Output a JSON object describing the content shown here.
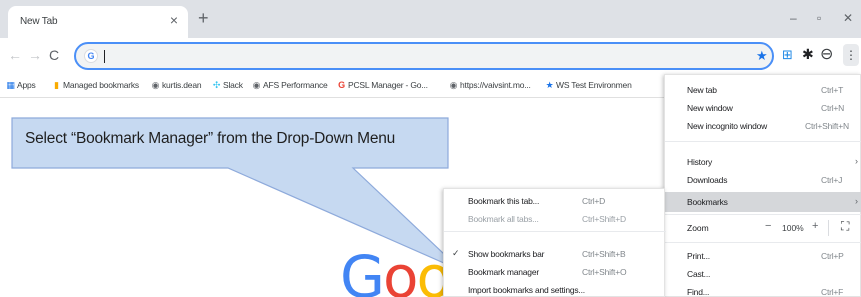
{
  "browser": {
    "tab_title": "New Tab",
    "tab_close": "×",
    "new_tab": "+",
    "window_controls": {
      "minimize": "–",
      "maximize": "▫",
      "close": "✕"
    }
  },
  "toolbar": {
    "back": "←",
    "forward": "→",
    "reload": "C",
    "omnibox_favicon": "G",
    "omnibox_value": "",
    "menu_glyph": "⋮"
  },
  "bookmarks_bar": [
    {
      "label": "Apps",
      "icon": "apps-grid-icon",
      "glyph": "▦",
      "color": "#1a73e8"
    },
    {
      "label": "Managed bookmarks",
      "icon": "folder-icon",
      "glyph": "▮",
      "color": "#f9ab00"
    },
    {
      "label": "kurtis.dean",
      "icon": "globe-icon",
      "glyph": "◉",
      "color": "#5f6368"
    },
    {
      "label": "Slack",
      "icon": "slack-icon",
      "glyph": "✣",
      "color": "#36c5f0"
    },
    {
      "label": "AFS Performance",
      "icon": "globe-icon",
      "glyph": "◉",
      "color": "#5f6368"
    },
    {
      "label": "PCSL Manager - Go...",
      "icon": "google-icon",
      "glyph": "G",
      "color": "#ea4335"
    },
    {
      "label": "https://vaivsint.mo...",
      "icon": "globe-icon",
      "glyph": "◉",
      "color": "#5f6368"
    },
    {
      "label": "WS Test Environmen",
      "icon": "star-icon",
      "glyph": "★",
      "color": "#1a73e8"
    }
  ],
  "main_menu": {
    "new_tab": {
      "label": "New tab",
      "shortcut": "Ctrl+T"
    },
    "new_window": {
      "label": "New window",
      "shortcut": "Ctrl+N"
    },
    "new_incognito": {
      "label": "New incognito window",
      "shortcut": "Ctrl+Shift+N"
    },
    "history": {
      "label": "History",
      "arrow": "›"
    },
    "downloads": {
      "label": "Downloads",
      "shortcut": "Ctrl+J"
    },
    "bookmarks": {
      "label": "Bookmarks",
      "arrow": "›"
    },
    "zoom": {
      "label": "Zoom",
      "minus": "−",
      "value": "100%",
      "plus": "+",
      "fullscreen": "⛶"
    },
    "print": {
      "label": "Print...",
      "shortcut": "Ctrl+P"
    },
    "cast": {
      "label": "Cast..."
    },
    "find": {
      "label": "Find...",
      "shortcut": "Ctrl+F"
    }
  },
  "bookmarks_menu": {
    "bookmark_tab": {
      "label": "Bookmark this tab...",
      "shortcut": "Ctrl+D"
    },
    "bookmark_all": {
      "label": "Bookmark all tabs...",
      "shortcut": "Ctrl+Shift+D"
    },
    "show_bar": {
      "label": "Show bookmarks bar",
      "shortcut": "Ctrl+Shift+B",
      "check": "✓"
    },
    "manager": {
      "label": "Bookmark manager",
      "shortcut": "Ctrl+Shift+O"
    },
    "import": {
      "label": "Import bookmarks and settings..."
    }
  },
  "page": {
    "logo_partial": "Goo"
  },
  "callout": {
    "text": "Select “Bookmark Manager” from the Drop-Down Menu",
    "fill": "#c6d9f1",
    "stroke": "#8eaadb"
  }
}
